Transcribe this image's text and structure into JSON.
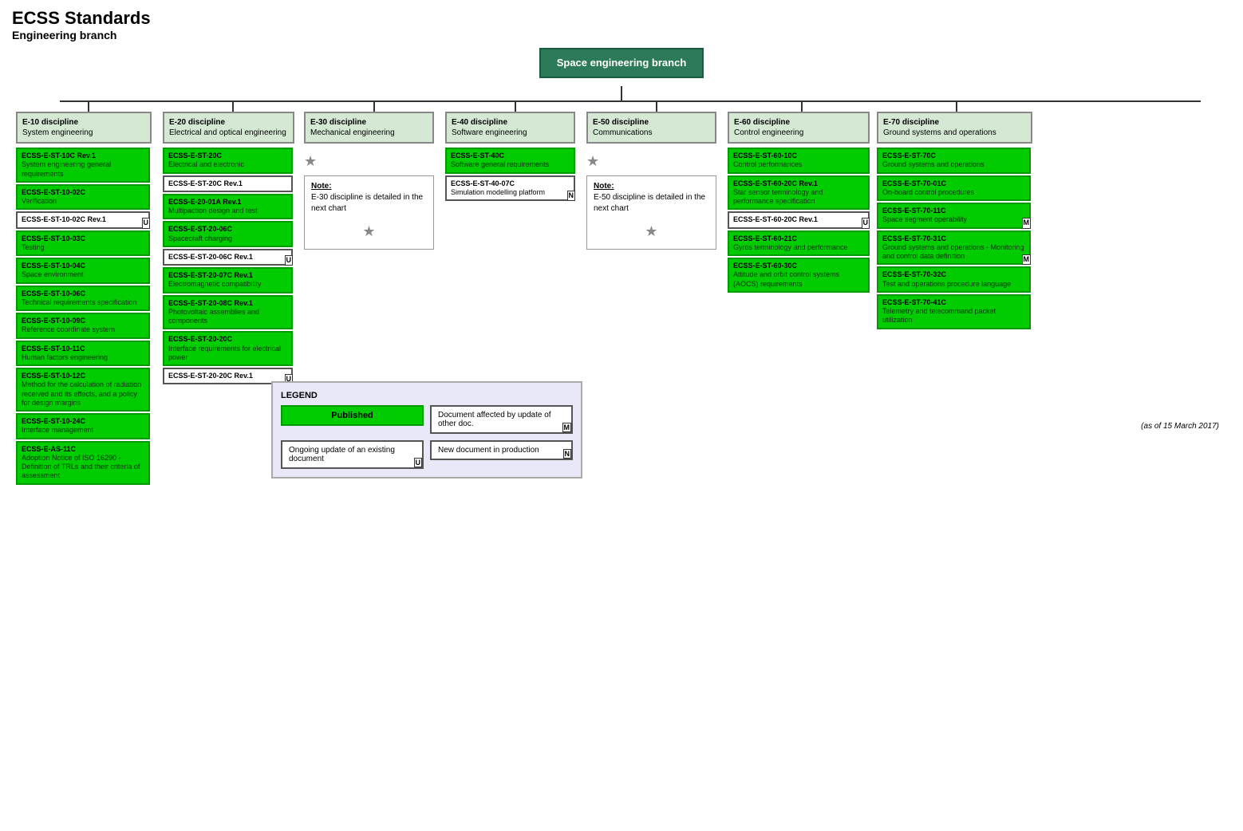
{
  "title": "ECSS Standards",
  "subtitle": "Engineering branch",
  "root": {
    "label": "Space engineering branch"
  },
  "asof": "(as of 15 March 2017)",
  "disciplines": [
    {
      "id": "E-10 discipline",
      "name": "System engineering",
      "docs": [
        {
          "id": "ECSS-E-ST-10C Rev.1",
          "name": "System engineering general requirements",
          "type": "green",
          "badge": null
        },
        {
          "id": "ECSS-E-ST-10-02C",
          "name": "Verification",
          "type": "green",
          "badge": null
        },
        {
          "id": "ECSS-E-ST-10-02C Rev.1",
          "name": "",
          "type": "white",
          "badge": "U"
        },
        {
          "id": "ECSS-E-ST-10-03C",
          "name": "Testing",
          "type": "green",
          "badge": null
        },
        {
          "id": "ECSS-E-ST-10-04C",
          "name": "Space environment",
          "type": "green",
          "badge": null
        },
        {
          "id": "ECSS-E-ST-10-06C",
          "name": "Technical requirements specification",
          "type": "green",
          "badge": null
        },
        {
          "id": "ECSS-E-ST-10-09C",
          "name": "Reference coordinate system",
          "type": "green",
          "badge": null
        },
        {
          "id": "ECSS-E-ST-10-11C",
          "name": "Human factors engineering",
          "type": "green",
          "badge": null
        },
        {
          "id": "ECSS-E-ST-10-12C",
          "name": "Method for the calculation of radiation received and its effects, and a policy for design margins",
          "type": "green",
          "badge": null
        },
        {
          "id": "ECSS-E-ST-10-24C",
          "name": "Interface management",
          "type": "green",
          "badge": null
        },
        {
          "id": "ECSS-E-AS-11C",
          "name": "Adoption Notice of ISO 16290 - Definition of TRLs and their criteria of assessment",
          "type": "green",
          "badge": null
        }
      ]
    },
    {
      "id": "E-20 discipline",
      "name": "Electrical and optical engineering",
      "docs": [
        {
          "id": "ECSS-E-ST-20C",
          "name": "Electrical and electronic",
          "type": "green",
          "badge": null
        },
        {
          "id": "ECSS-E-ST-20C Rev.1",
          "name": "",
          "type": "white",
          "badge": null
        },
        {
          "id": "ECSS-E-20-01A Rev.1",
          "name": "Multipaction design and test",
          "type": "green",
          "badge": null
        },
        {
          "id": "ECSS-E-ST-20-06C",
          "name": "Spacecraft charging",
          "type": "green",
          "badge": null
        },
        {
          "id": "ECSS-E-ST-20-06C Rev.1",
          "name": "",
          "type": "white",
          "badge": "U"
        },
        {
          "id": "ECSS-E-ST-20-07C Rev.1",
          "name": "Electromagnetic compatibility",
          "type": "green",
          "badge": null
        },
        {
          "id": "ECSS-E-ST-20-08C Rev.1",
          "name": "Photovoltaic assemblies and components",
          "type": "green",
          "badge": null
        },
        {
          "id": "ECSS-E-ST-20-20C",
          "name": "Interface requirements for electrical power",
          "type": "green",
          "badge": null
        },
        {
          "id": "ECSS-E-ST-20-20C Rev.1",
          "name": "",
          "type": "white",
          "badge": "U"
        }
      ]
    },
    {
      "id": "E-30 discipline",
      "name": "Mechanical engineering",
      "note": "Note:\nE-30 discipline is detailed in the next chart",
      "star": true,
      "docs": []
    },
    {
      "id": "E-40 discipline",
      "name": "Software engineering",
      "docs": [
        {
          "id": "ECSS-E-ST-40C",
          "name": "Software general requirements",
          "type": "green",
          "badge": null
        },
        {
          "id": "ECSS-E-ST-40-07C",
          "name": "Simulation modelling platform",
          "type": "white",
          "badge": "N"
        }
      ]
    },
    {
      "id": "E-50 discipline",
      "name": "Communications",
      "note": "Note:\nE-50 discipline is detailed in the next chart",
      "star": true,
      "docs": []
    },
    {
      "id": "E-60 discipline",
      "name": "Control engineering",
      "docs": [
        {
          "id": "ECSS-E-ST-60-10C",
          "name": "Control performances",
          "type": "green",
          "badge": null
        },
        {
          "id": "ECSS-E-ST-60-20C Rev.1",
          "name": "Star sensor terminology and performance specification",
          "type": "green",
          "badge": null
        },
        {
          "id": "ECSS-E-ST-60-20C Rev.1",
          "name": "",
          "type": "white",
          "badge": "U"
        },
        {
          "id": "ECSS-E-ST-60-21C",
          "name": "Gyros terminology and performance",
          "type": "green",
          "badge": null
        },
        {
          "id": "ECSS-E-ST-60-30C",
          "name": "Attitude and orbit control systems (AOCS) requirements",
          "type": "green",
          "badge": null
        }
      ]
    },
    {
      "id": "E-70 discipline",
      "name": "Ground systems and operations",
      "docs": [
        {
          "id": "ECSS-E-ST-70C",
          "name": "Ground systems and operations",
          "type": "green",
          "badge": null
        },
        {
          "id": "ECSS-E-ST-70-01C",
          "name": "On-board control procedures",
          "type": "green",
          "badge": null
        },
        {
          "id": "ECSS-E-ST-70-11C",
          "name": "Space segment operability",
          "type": "green",
          "badge": "M"
        },
        {
          "id": "ECSS-E-ST-70-31C",
          "name": "Ground systems and operations - Monitoring and control data definition",
          "type": "green",
          "badge": "M"
        },
        {
          "id": "ECSS-E-ST-70-32C",
          "name": "Test and operations procedure language",
          "type": "green",
          "badge": null
        },
        {
          "id": "ECSS-E-ST-70-41C",
          "name": "Telemetry and telecommand packet utilization",
          "type": "green",
          "badge": null
        }
      ]
    }
  ],
  "legend": {
    "title": "LEGEND",
    "items": [
      {
        "label": "Published",
        "type": "green",
        "badge": null
      },
      {
        "label": "Document affected by update of other doc.",
        "type": "white",
        "badge": "M"
      },
      {
        "label": "Ongoing update of an existing document",
        "type": "white",
        "badge": "U"
      },
      {
        "label": "New document in production",
        "type": "white",
        "badge": "N"
      }
    ]
  }
}
